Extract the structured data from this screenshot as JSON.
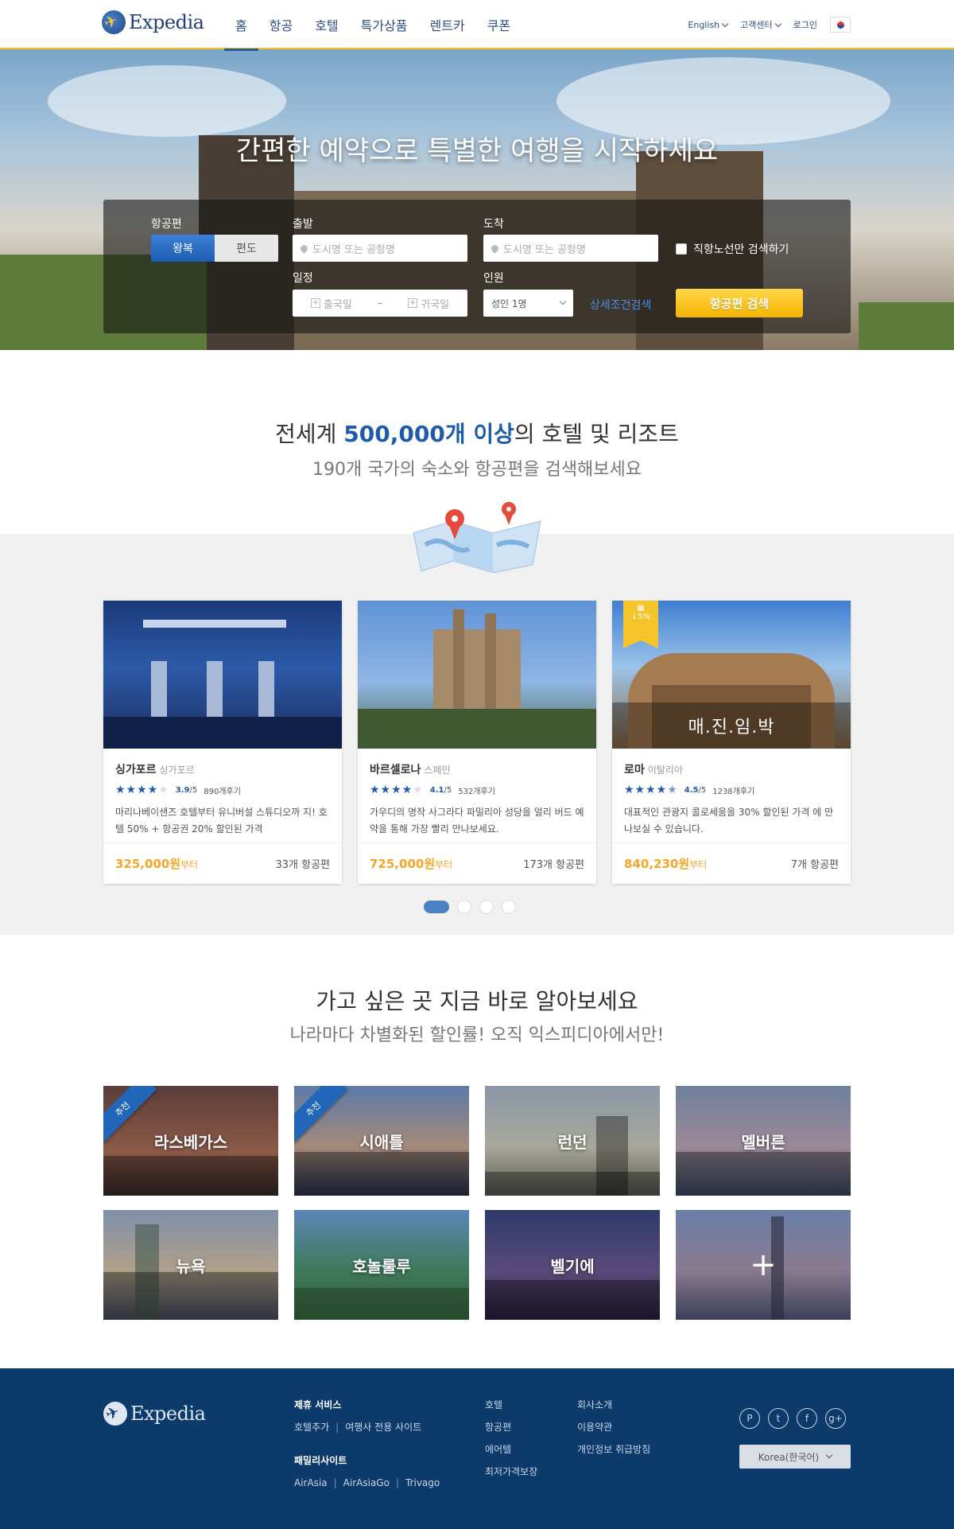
{
  "header": {
    "logo_text": "Expedia",
    "nav": [
      "홈",
      "항공",
      "호텔",
      "특가상품",
      "렌트카",
      "쿠폰"
    ],
    "lang": "English",
    "support": "고객센터",
    "login": "로그인"
  },
  "hero": {
    "title": "간편한 예약으로 특별한 여행을 시작하세요",
    "flight_label": "항공편",
    "roundtrip": "왕복",
    "oneway": "편도",
    "depart_label": "출발",
    "depart_placeholder": "도시명 또는 공항명",
    "arrive_label": "도착",
    "arrive_placeholder": "도시명 또는 공항명",
    "direct_only": "직항노선만 검색하기",
    "schedule_label": "일정",
    "depart_date": "출국일",
    "date_sep": "–",
    "return_date": "귀국일",
    "pax_label": "인원",
    "pax_value": "성인 1명",
    "advanced": "상세조건검색",
    "search_button": "항공편 검색"
  },
  "promo": {
    "title_pre": "전세계 ",
    "title_hl": "500,000개 이상",
    "title_post": "의 호텔 및 리조트",
    "subtitle": "190개 국가의 숙소와 항공편을 검색해보세요",
    "cards": [
      {
        "city": "싱가포르",
        "country": "싱가포르",
        "stars": 4,
        "score": "3.9",
        "score_max": "/5",
        "reviews": "890개후기",
        "desc": "마리나베이샌즈 호텔부터 유니버설 스튜디오까 지! 호텔 50% + 항공권 20% 할인된 가격",
        "price": "325,000원",
        "price_suffix": "부터",
        "flights": "33개 항공편"
      },
      {
        "city": "바르셀로나",
        "country": "스페인",
        "stars": 4,
        "score": "4.1",
        "score_max": "/5",
        "reviews": "532개후기",
        "desc": "가우디의 명작 사그라다 파밀리아 성당을 얼리 버드 예약을 통해 가장 빨리 만나보세요.",
        "price": "725,000원",
        "price_suffix": "부터",
        "flights": "173개 항공편"
      },
      {
        "city": "로마",
        "country": "이탈리아",
        "stars": 4.5,
        "score": "4.5",
        "score_max": "/5",
        "reviews": "1238개후기",
        "desc": "대표적인 관광지 콜로세움을 30% 할인된 가격 에 만나보실 수 있습니다.",
        "price": "840,230원",
        "price_suffix": "부터",
        "flights": "7개 항공편",
        "badge": "↓5%",
        "caption": "매.진.임.박"
      }
    ],
    "carousel_pages": 4,
    "carousel_active": 1
  },
  "destinations": {
    "title": "가고 싶은 곳 지금 바로 알아보세요",
    "subtitle": "나라마다 차별화된 할인률! 오직 익스피디아에서만!",
    "ribbon": "추천",
    "tiles": [
      "라스베가스",
      "시애틀",
      "런던",
      "멜버른",
      "뉴욕",
      "호놀룰루",
      "벨기에",
      "+"
    ]
  },
  "footer": {
    "logo_text": "Expedia",
    "partner_head": "제휴 서비스",
    "partner_links": [
      "호텔추가",
      "여행사 전용 사이트"
    ],
    "family_head": "패밀리사이트",
    "family_links": [
      "AirAsia",
      "AirAsiaGo",
      "Trivago"
    ],
    "col3": [
      "호텔",
      "항공편",
      "에어텔",
      "최저가격보장"
    ],
    "col4": [
      "회사소개",
      "이용약관",
      "개인정보 취급방침"
    ],
    "social": [
      "pinterest-icon",
      "twitter-icon",
      "facebook-icon",
      "google-plus-icon"
    ],
    "region": "Korea(한국어)"
  }
}
